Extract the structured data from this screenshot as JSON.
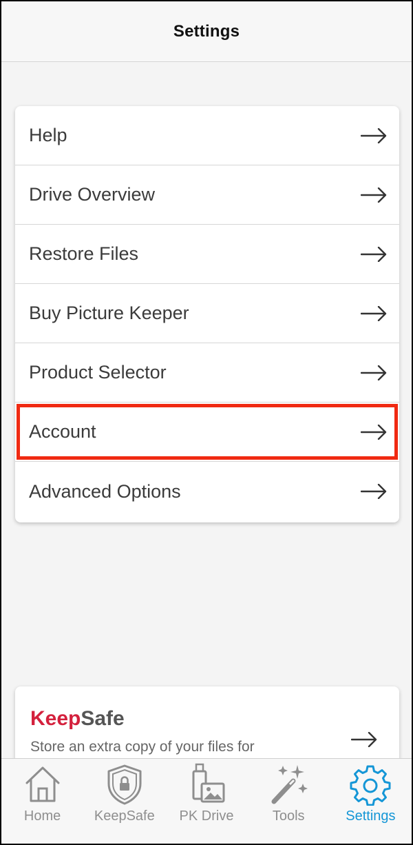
{
  "header": {
    "title": "Settings"
  },
  "menu": {
    "items": [
      {
        "label": "Help"
      },
      {
        "label": "Drive Overview"
      },
      {
        "label": "Restore Files"
      },
      {
        "label": "Buy Picture Keeper"
      },
      {
        "label": "Product Selector"
      },
      {
        "label": "Account",
        "highlighted": true
      },
      {
        "label": "Advanced Options"
      }
    ],
    "arrow_icon": "arrow-right-icon"
  },
  "keepsafe_promo": {
    "title_part1": "Keep",
    "title_part2": "Safe",
    "description": "Store an extra copy of your files for"
  },
  "tabbar": {
    "tabs": [
      {
        "label": "Home",
        "icon": "home-icon"
      },
      {
        "label": "KeepSafe",
        "icon": "shield-lock-icon"
      },
      {
        "label": "PK Drive",
        "icon": "usb-drive-icon"
      },
      {
        "label": "Tools",
        "icon": "magic-wand-icon"
      },
      {
        "label": "Settings",
        "icon": "gear-icon",
        "active": true
      }
    ]
  },
  "colors": {
    "accent": "#1496d6",
    "highlight": "#f02a12",
    "brand_red": "#d4213d"
  }
}
